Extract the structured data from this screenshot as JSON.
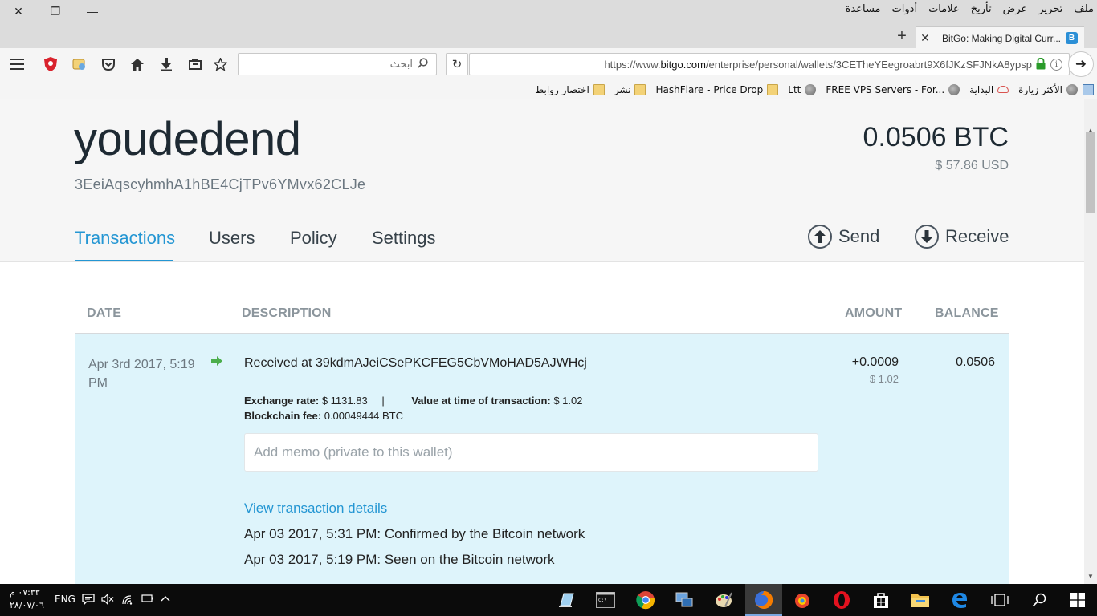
{
  "browser": {
    "menu": [
      "ملف",
      "تحرير",
      "عرض",
      "تأريخ",
      "علامات",
      "أدوات",
      "مساعدة"
    ],
    "tab_title": "BitGo: Making Digital Curr...",
    "new_tab": "+",
    "search_placeholder": "ابحث",
    "url_prefix": "https://www.",
    "url_host": "bitgo.com",
    "url_path": "/enterprise/personal/wallets/3CETheYEegroabrt9X6fJKzSFJNkA8ypsp",
    "bookmarks": [
      {
        "label": "الأكثر زيارة",
        "icon": "globe-icon"
      },
      {
        "label": "البداية",
        "icon": "cloud-icon"
      },
      {
        "label": "FREE VPS Servers - For...",
        "icon": "globe-icon"
      },
      {
        "label": "Ltt",
        "icon": "globe-icon"
      },
      {
        "label": "HashFlare - Price Drop",
        "icon": "folder-icon"
      },
      {
        "label": "نشر",
        "icon": "folder-icon"
      },
      {
        "label": "اختصار روابط",
        "icon": "folder-icon"
      }
    ]
  },
  "wallet": {
    "name": "youdedend",
    "address": "3EeiAqscyhmhA1hBE4CjTPv6YMvx62CLJe",
    "balance_btc": "0.0506 BTC",
    "balance_usd": "$ 57.86 USD"
  },
  "nav": {
    "tabs": [
      "Transactions",
      "Users",
      "Policy",
      "Settings"
    ],
    "active": "Transactions",
    "send": "Send",
    "receive": "Receive"
  },
  "table": {
    "headers": [
      "DATE",
      "DESCRIPTION",
      "AMOUNT",
      "BALANCE"
    ]
  },
  "transaction": {
    "date": "Apr 3rd 2017, 5:19 PM",
    "description": "Received at 39kdmAJeiCSePKCFEG5CbVMoHAD5AJWHcj",
    "amount": "+0.0009",
    "amount_usd": "$ 1.02",
    "balance": "0.0506",
    "exchange_rate_label": "Exchange rate:",
    "exchange_rate_value": "$ 1131.83",
    "separator": "|",
    "value_label": "Value at time of transaction:",
    "value_value": "$ 1.02",
    "fee_label": "Blockchain fee:",
    "fee_value": "0.00049444 BTC",
    "memo_placeholder": "Add memo (private to this wallet)",
    "details_link": "View transaction details",
    "events": [
      "Apr 03 2017, 5:31 PM: Confirmed by the Bitcoin network",
      "Apr 03 2017, 5:19 PM: Seen on the Bitcoin network"
    ]
  },
  "taskbar": {
    "time": "٠٧:٣٣ م",
    "date": "٢٨/٠٧/٠٦",
    "language": "ENG"
  },
  "colors": {
    "accent": "#2496d3",
    "header_bg": "#f6f6f6",
    "tx_bg": "#def4fb",
    "arrow_green": "#4cae4c"
  }
}
